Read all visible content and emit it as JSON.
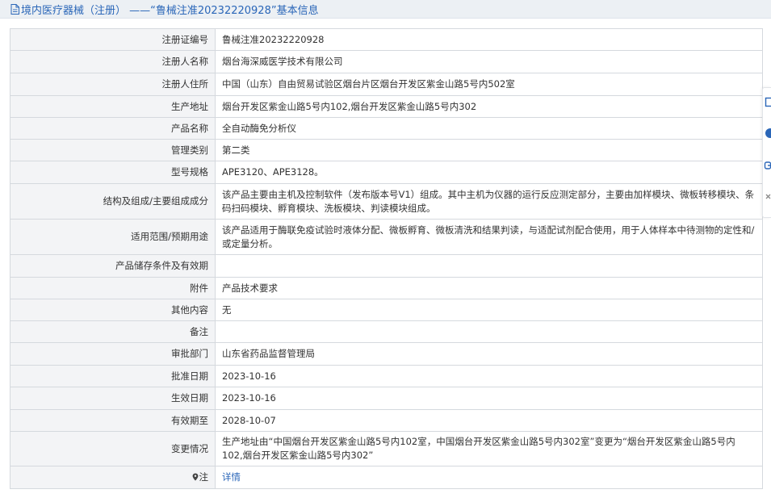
{
  "header": {
    "title": "境内医疗器械（注册） ——“鲁械注准20232220928”基本信息",
    "accent_color": "#2a66b8",
    "icon": "document-icon"
  },
  "rows": [
    {
      "label": "注册证编号",
      "value": "鲁械注准20232220928"
    },
    {
      "label": "注册人名称",
      "value": "烟台海深威医学技术有限公司"
    },
    {
      "label": "注册人住所",
      "value": "中国（山东）自由贸易试验区烟台片区烟台开发区紫金山路5号内502室"
    },
    {
      "label": "生产地址",
      "value": "烟台开发区紫金山路5号内102,烟台开发区紫金山路5号内302"
    },
    {
      "label": "产品名称",
      "value": "全自动酶免分析仪"
    },
    {
      "label": "管理类别",
      "value": "第二类"
    },
    {
      "label": "型号规格",
      "value": "APE3120、APE3128。"
    },
    {
      "label": "结构及组成/主要组成成分",
      "value": "该产品主要由主机及控制软件（发布版本号V1）组成。其中主机为仪器的运行反应测定部分，主要由加样模块、微板转移模块、条码扫码模块、孵育模块、洗板模块、判读模块组成。"
    },
    {
      "label": "适用范围/预期用途",
      "value": "该产品适用于酶联免疫试验时液体分配、微板孵育、微板清洗和结果判读，与适配试剂配合使用，用于人体样本中待测物的定性和/或定量分析。"
    },
    {
      "label": "产品储存条件及有效期",
      "value": ""
    },
    {
      "label": "附件",
      "value": "产品技术要求"
    },
    {
      "label": "其他内容",
      "value": "无"
    },
    {
      "label": "备注",
      "value": ""
    },
    {
      "label": "审批部门",
      "value": "山东省药品监督管理局"
    },
    {
      "label": "批准日期",
      "value": "2023-10-16"
    },
    {
      "label": "生效日期",
      "value": "2023-10-16"
    },
    {
      "label": "有效期至",
      "value": "2028-10-07"
    },
    {
      "label": "变更情况",
      "value": "生产地址由“中国烟台开发区紫金山路5号内102室，中国烟台开发区紫金山路5号内302室”变更为“烟台开发区紫金山路5号内102,烟台开发区紫金山路5号内302”"
    },
    {
      "label": "注",
      "value": "详情",
      "label_icon": "map-pin-icon"
    }
  ],
  "side_tools": [
    "copy-icon",
    "circle-icon",
    "link-icon",
    "close-icon"
  ]
}
